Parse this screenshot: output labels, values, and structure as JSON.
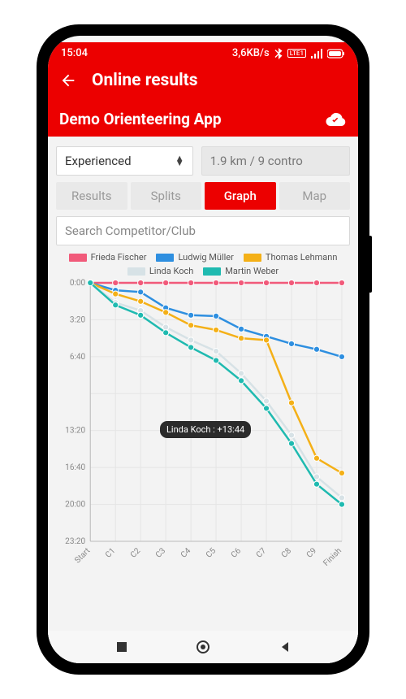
{
  "status": {
    "time": "15:04",
    "net_speed": "3,6KB/s",
    "lte_label": "LTE1"
  },
  "appbar": {
    "title": "Online results"
  },
  "subbar": {
    "title": "Demo Orienteering App"
  },
  "controls": {
    "class_selected": "Experienced",
    "course_info": "1.9 km / 9 contro",
    "search_placeholder": "Search Competitor/Club"
  },
  "tabs": {
    "t0": "Results",
    "t1": "Splits",
    "t2": "Graph",
    "t3": "Map",
    "active_index": 2
  },
  "tooltip": {
    "text": "Linda Koch : +13:44"
  },
  "chart_data": {
    "type": "line",
    "title": "",
    "xlabel": "",
    "ylabel": "",
    "ylim_minutes": [
      0,
      23.33
    ],
    "y_ticks": [
      "0:00",
      "3:20",
      "6:40",
      "",
      "13:20",
      "16:40",
      "20:00",
      "23:20"
    ],
    "categories": [
      "Start",
      "C1",
      "C2",
      "C3",
      "C4",
      "C5",
      "C6",
      "C7",
      "C8",
      "C9",
      "Finish"
    ],
    "series": [
      {
        "name": "Frieda Fischer",
        "color": "#f15a7a",
        "values_min": [
          0,
          0,
          0,
          0,
          0,
          0,
          0,
          0,
          0,
          0,
          0
        ]
      },
      {
        "name": "Ludwig Müller",
        "color": "#2e8fe0",
        "values_min": [
          0,
          0.67,
          0.83,
          2.25,
          2.92,
          3.0,
          4.17,
          4.83,
          5.5,
          6.0,
          6.67
        ]
      },
      {
        "name": "Thomas Lehmann",
        "color": "#f4b017",
        "values_min": [
          0,
          1.0,
          1.67,
          2.67,
          3.83,
          4.25,
          5.0,
          5.17,
          10.83,
          15.83,
          17.17
        ]
      },
      {
        "name": "Linda Koch",
        "color": "#d7e2e6",
        "values_min": [
          0,
          1.78,
          2.5,
          4.0,
          5.17,
          6.17,
          8.17,
          10.67,
          13.75,
          17.5,
          19.4
        ]
      },
      {
        "name": "Martin Weber",
        "color": "#1fbab0",
        "values_min": [
          0,
          2.0,
          2.92,
          4.5,
          5.83,
          7.0,
          8.83,
          11.33,
          14.5,
          18.17,
          20.0
        ]
      }
    ]
  },
  "legend": {
    "l0": "Frieda Fischer",
    "l1": "Ludwig Müller",
    "l2": "Thomas Lehmann",
    "l3": "Linda Koch",
    "l4": "Martin Weber"
  }
}
